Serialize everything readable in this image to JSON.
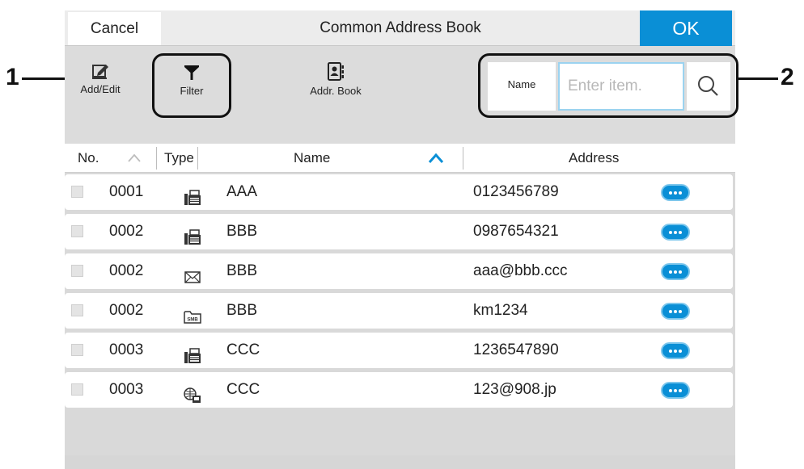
{
  "topbar": {
    "cancel_label": "Cancel",
    "title": "Common Address Book",
    "ok_label": "OK",
    "accent_color": "#0a8fd6"
  },
  "toolbar": {
    "add_edit_label": "Add/Edit",
    "filter_label": "Filter",
    "addr_book_label": "Addr. Book",
    "search_key_label": "Name",
    "search_placeholder": "Enter item.",
    "search_value": ""
  },
  "table": {
    "headers": {
      "no": "No.",
      "type": "Type",
      "name": "Name",
      "address": "Address"
    },
    "rows": [
      {
        "no": "0001",
        "type_icon": "fax-icon",
        "name": "AAA",
        "address": "0123456789"
      },
      {
        "no": "0002",
        "type_icon": "fax-icon",
        "name": "BBB",
        "address": "0987654321"
      },
      {
        "no": "0002",
        "type_icon": "email-icon",
        "name": "BBB",
        "address": "aaa@bbb.ccc"
      },
      {
        "no": "0002",
        "type_icon": "smb-folder-icon",
        "name": "BBB",
        "address": "km1234"
      },
      {
        "no": "0003",
        "type_icon": "fax-icon",
        "name": "CCC",
        "address": "1236547890"
      },
      {
        "no": "0003",
        "type_icon": "i-fax-icon",
        "name": "CCC",
        "address": "123@908.jp"
      }
    ]
  },
  "callouts": {
    "one": "1",
    "two": "2"
  }
}
